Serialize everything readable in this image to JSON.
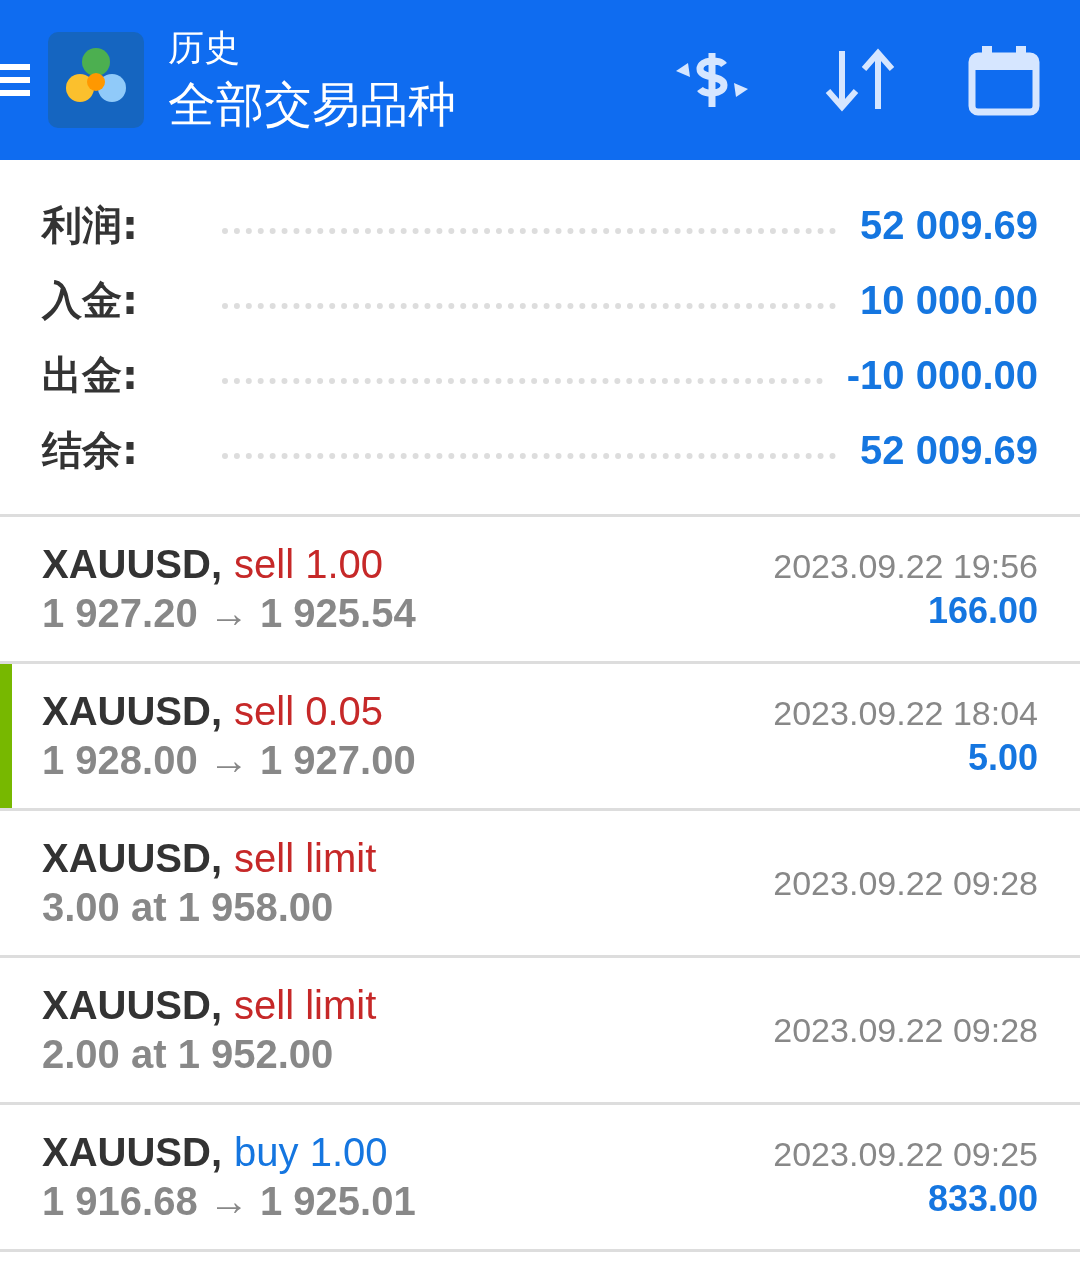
{
  "header": {
    "title": "历史",
    "subtitle": "全部交易品种"
  },
  "summary": [
    {
      "label": "利润:",
      "value": "52 009.69"
    },
    {
      "label": "入金:",
      "value": "10 000.00"
    },
    {
      "label": "出金:",
      "value": "-10 000.00"
    },
    {
      "label": "结余:",
      "value": "52 009.69"
    }
  ],
  "orders": [
    {
      "symbol": "XAUUSD,",
      "kind": "sell",
      "action": "sell 1.00",
      "prices": "1 927.20 → 1 925.54",
      "time": "2023.09.22 19:56",
      "profit": "166.00",
      "selected": false
    },
    {
      "symbol": "XAUUSD,",
      "kind": "sell",
      "action": "sell 0.05",
      "prices": "1 928.00 → 1 927.00",
      "time": "2023.09.22 18:04",
      "profit": "5.00",
      "selected": true
    },
    {
      "symbol": "XAUUSD,",
      "kind": "sell",
      "action": "sell limit",
      "prices": "3.00 at 1 958.00",
      "time": "2023.09.22 09:28",
      "selected": false
    },
    {
      "symbol": "XAUUSD,",
      "kind": "sell",
      "action": "sell limit",
      "prices": "2.00 at 1 952.00",
      "time": "2023.09.22 09:28",
      "selected": false
    },
    {
      "symbol": "XAUUSD,",
      "kind": "buy",
      "action": "buy 1.00",
      "prices": "1 916.68 → 1 925.01",
      "time": "2023.09.22 09:25",
      "profit": "833.00",
      "selected": false
    }
  ]
}
